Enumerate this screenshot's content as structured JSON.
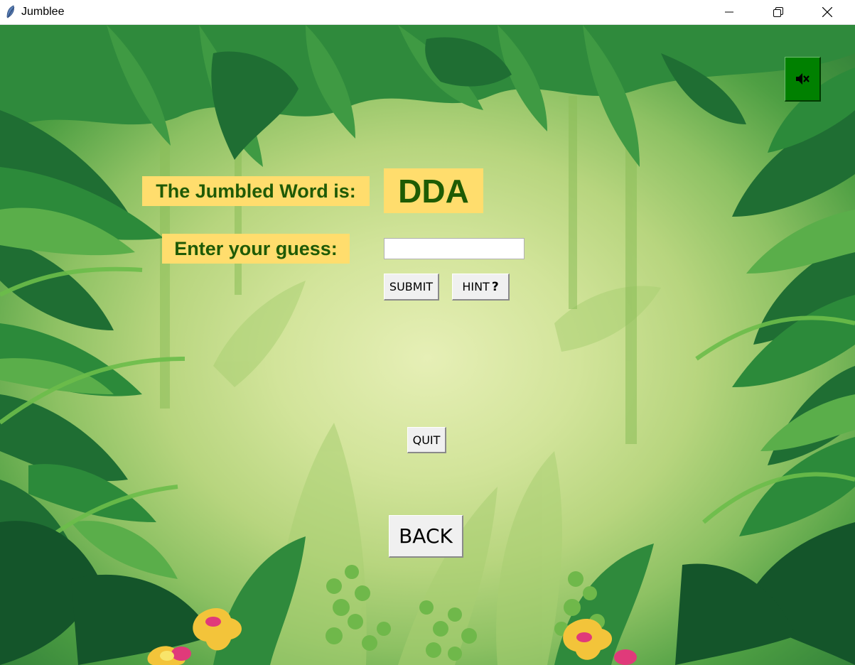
{
  "window": {
    "title": "Jumblee",
    "icon": "feather-icon",
    "controls": [
      "minimize-icon",
      "restore-icon",
      "close-icon"
    ]
  },
  "game": {
    "jumbled_label": "The Jumbled Word is:",
    "jumbled_word": "DDA",
    "guess_label": "Enter your guess:",
    "guess_value": "",
    "submit_label": "SUBMIT",
    "hint_label": "HINT",
    "hint_symbol": "?",
    "quit_label": "QUIT",
    "back_label": "BACK",
    "mute_icon": "speaker-mute-icon"
  },
  "colors": {
    "label_bg": "#ffdd6d",
    "label_text": "#1f5a06",
    "mute_button_bg": "#008000",
    "button_bg": "#f0f0f0"
  }
}
